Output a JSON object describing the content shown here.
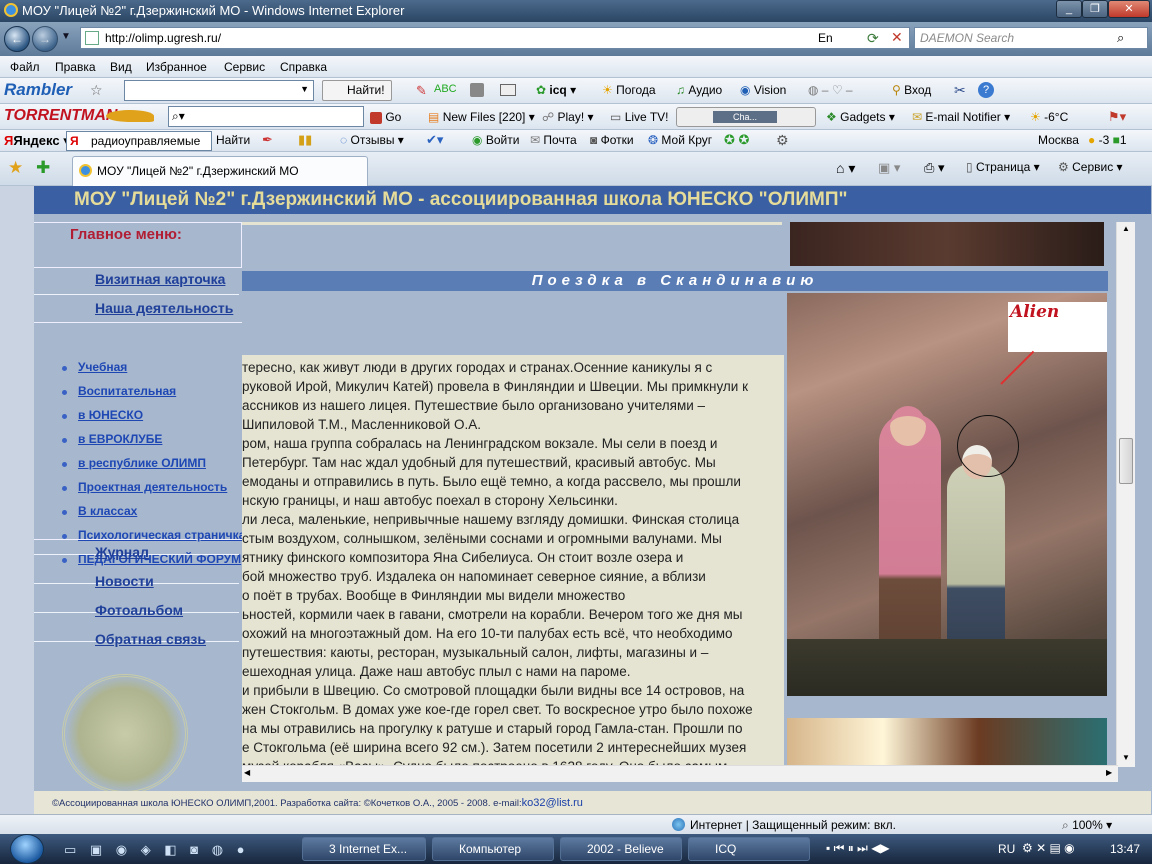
{
  "window": {
    "title": "МОУ \"Лицей №2\" г.Дзержинский МО - Windows Internet Explorer"
  },
  "address": {
    "url": "http://olimp.ugresh.ru/",
    "search_placeholder": "DAEMON Search",
    "lang": "En"
  },
  "menu": [
    "Файл",
    "Правка",
    "Вид",
    "Избранное",
    "Сервис",
    "Справка"
  ],
  "toolbar1": {
    "brand": "Rambler",
    "find": "Найти!",
    "icq": "icq",
    "weather": "Погода",
    "audio": "Аудио",
    "vision": "Vision",
    "login": "Вход"
  },
  "toolbar2": {
    "brand": "TORRENTMAN",
    "go": "Go",
    "newfiles": "New Files [220]",
    "play": "Play!",
    "livetv": "Live TV!",
    "channel": "Cha...",
    "gadgets": "Gadgets",
    "email": "E-mail Notifier",
    "temp": "-6°C"
  },
  "toolbar3": {
    "brand": "Яндекс",
    "query": "радиоуправляемые м",
    "find": "Найти",
    "reviews": "Отзывы",
    "enter": "Войти",
    "mail": "Почта",
    "photos": "Фотки",
    "circle": "Мой Круг",
    "city": "Москва",
    "w1": "-3",
    "w2": "1"
  },
  "tab": {
    "title": "МОУ \"Лицей №2\" г.Дзержинский МО",
    "page": "Страница",
    "service": "Сервис"
  },
  "site": {
    "banner": "МОУ \"Лицей №2\" г.Дзержинский МО - ассоциированная школа ЮНЕСКО \"ОЛИМП\"",
    "menu_title": "Главное меню:",
    "menu_top": [
      "Визитная карточка",
      "Наша деятельность"
    ],
    "submenu": [
      "Учебная",
      "Воспитательная",
      "в ЮНЕСКО",
      "в ЕВРОКЛУБЕ",
      "в республике ОЛИМП",
      "Проектная деятельность",
      "В классах",
      "Психологическая страничка",
      "ПЕДАГОГИЧЕСКИЙ ФОРУМ"
    ],
    "menu_bottom": [
      "Журнал",
      "Новости",
      "Фотоальбом",
      "Обратная связь"
    ],
    "section_title": "Поездка в Скандинавию",
    "photo_label": "Alien",
    "article": [
      "тересно, как живут люди в других городах и странах.Осенние каникулы я с",
      "руковой Ирой, Микулич Катей) провела в Финляндии и Швеции. Мы примкнули к",
      "ассников из нашего лицея. Путешествие было организовано учителями –",
      " Шипиловой Т.М., Масленниковой О.А.",
      "ром, наша группа собралась на Ленинградском вокзале. Мы сели в поезд и",
      "Петербург. Там нас ждал удобный для путешествий, красивый автобус. Мы",
      "емоданы и отправились в путь. Было ещё темно, а когда рассвело, мы прошли",
      "нскую границы, и наш автобус поехал в сторону Хельсинки.",
      "ли леса, маленькие, непривычные нашему взгляду домишки. Финская столица",
      "стым воздухом, солнышком, зелёными соснами и огромными валунами. Мы",
      "ятнику финского композитора Яна Сибелиуса. Он стоит возле озера и",
      "бой множество труб. Издалека он напоминает северное сияние, а вблизи",
      "о поёт в трубах. Вообще в Финляндии мы видели множество",
      "ьностей, кормили чаек в гавани, смотрели на корабли. Вечером того же дня мы",
      "охожий на многоэтажный дом. На его 10-ти палубах есть всё, что необходимо",
      " путешествия: каюты, ресторан, музыкальный салон, лифты, магазины и –",
      "ешеходная улица. Даже наш автобус плыл с нами на пароме.",
      "и прибыли в Швецию. Со смотровой площадки были видны все 14 островов, на",
      "жен Стокгольм. В домах уже кое-где горел свет. То воскресное утро было похоже",
      "на мы отравились на прогулку к ратуше и старый город Гамла-стан. Прошли по",
      "е Стокгольма (её ширина всего 92 см.). Затем посетили 2 интереснейших музея",
      "музей корабля «Васы». Судно было построено в 1628 году. Оно было самым"
    ],
    "footer": "©Ассоциированная школа ЮНЕСКО ОЛИМП,2001. Разработка сайта: ©Кочетков О.А., 2005 - 2008. e-mail:",
    "footer_email": "ko32@list.ru"
  },
  "status": {
    "zone": "Интернет | Защищенный режим: вкл.",
    "zoom": "100%"
  },
  "taskbar": {
    "items": [
      "3 Internet Ex...",
      "Компьютер",
      "2002 - Believe",
      "ICQ"
    ],
    "lang": "RU",
    "time": "13:47"
  }
}
